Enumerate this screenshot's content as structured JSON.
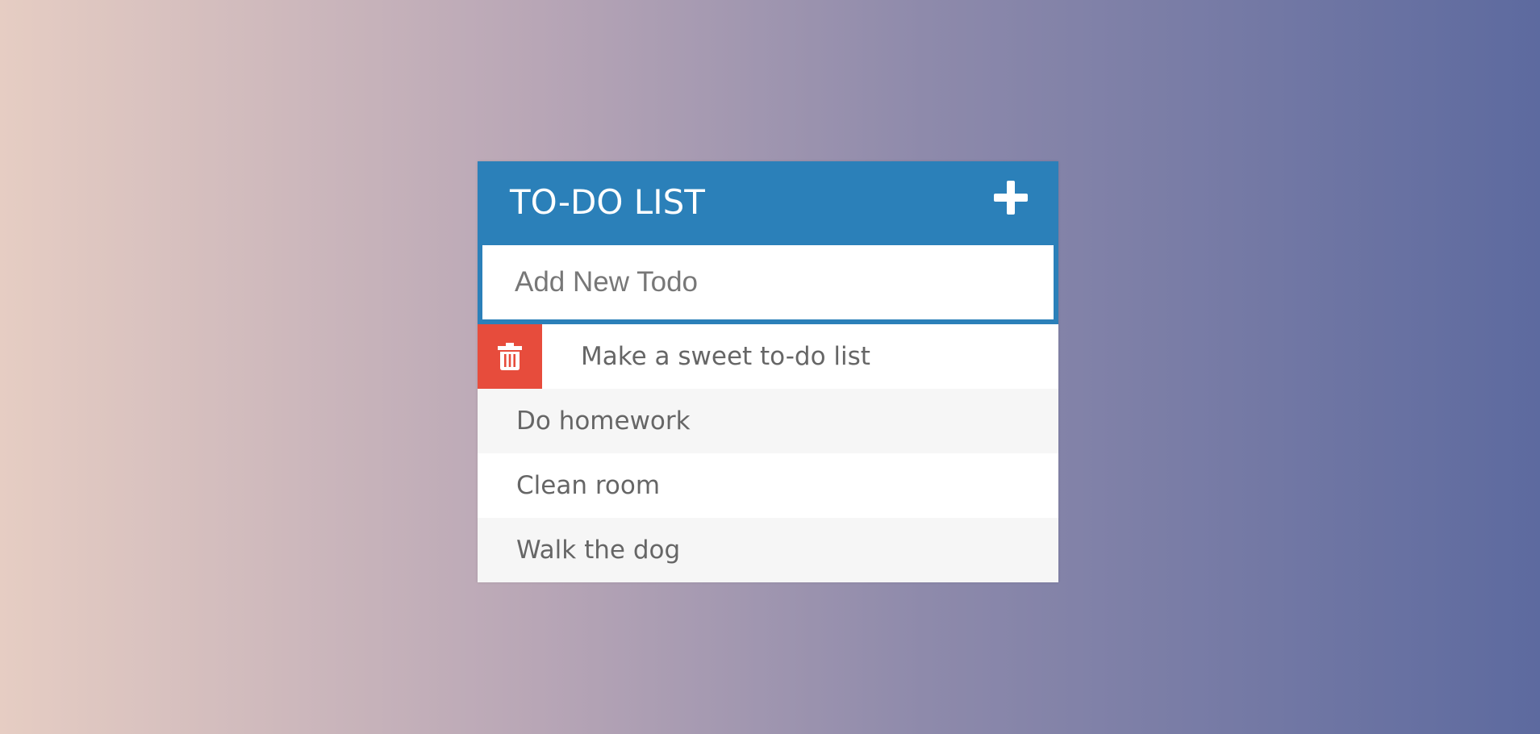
{
  "header": {
    "title": "TO-DO LIST",
    "add_icon": "plus-icon"
  },
  "new_todo": {
    "placeholder": "Add New Todo",
    "value": ""
  },
  "todos": [
    {
      "text": "Make a sweet to-do list",
      "delete_icon": "trash-icon",
      "hover": true
    },
    {
      "text": "Do homework"
    },
    {
      "text": "Clean room"
    },
    {
      "text": "Walk the dog"
    }
  ],
  "colors": {
    "header": "#2b80b9",
    "delete": "#e74c3c",
    "row_even": "#f6f6f6",
    "row_odd": "#ffffff",
    "text": "#666666",
    "gradient_left": "#e6cdc3",
    "gradient_right": "#5d6a9f"
  }
}
